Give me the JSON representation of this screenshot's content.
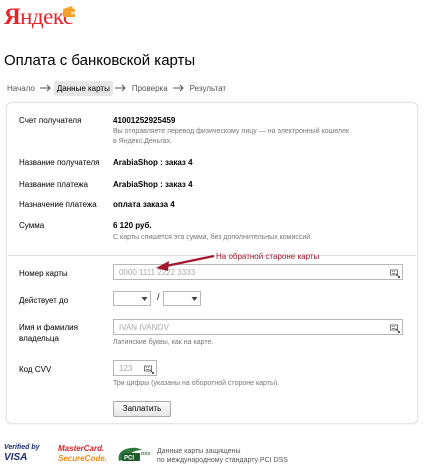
{
  "header": {
    "logo_first": "Я",
    "logo_rest": "ндекс"
  },
  "page": {
    "title": "Оплата с банковской карты"
  },
  "steps": [
    {
      "label": "Начало",
      "active": false
    },
    {
      "label": "Данные карты",
      "active": true
    },
    {
      "label": "Проверка",
      "active": false
    },
    {
      "label": "Результат",
      "active": false
    }
  ],
  "details": {
    "account_label": "Счет получателя",
    "account_value": "41001252925459",
    "account_note": "Вы отправляете перевод физическому лицу — на электронный кошелек в Яндекс.Деньгах.",
    "recipient_label": "Название получателя",
    "recipient_value": "ArabiaShop : заказ 4",
    "payment_name_label": "Название платежа",
    "payment_name_value": "ArabiaShop : заказ 4",
    "purpose_label": "Назначение платежа",
    "purpose_value": "оплата заказа 4",
    "amount_label": "Сумма",
    "amount_value": "6 120 руб.",
    "amount_note": "С карты спишется эта сумма, без дополнительных комиссий."
  },
  "form": {
    "card_number_label": "Номер карты",
    "card_number_placeholder": "0000 1111 2222 3333",
    "valid_label": "Действует до",
    "valid_separator": "/",
    "holder_label": "Имя и фамилия владельца",
    "holder_placeholder": "IVAN IVANOV",
    "holder_note": "Латинские буквы, как на карте.",
    "cvv_label": "Код CVV",
    "cvv_placeholder": "123",
    "cvv_note": "Три цифры (указаны на оборотной стороне карты).",
    "annotation": "На обратной староне карты",
    "pay_button": "Заплатить"
  },
  "footer": {
    "verified_line1": "Verified by",
    "verified_line2": "VISA",
    "mc_line1": "MasterCard.",
    "mc_line2": "SecureCode.",
    "pci_logo": "PCI DSS",
    "pci_text_line1": "Данные карты защищены",
    "pci_text_line2": "по международному стандарту PCI DSS"
  },
  "colors": {
    "brand_red": "#e3252b",
    "annotation_red": "#a3182e"
  }
}
